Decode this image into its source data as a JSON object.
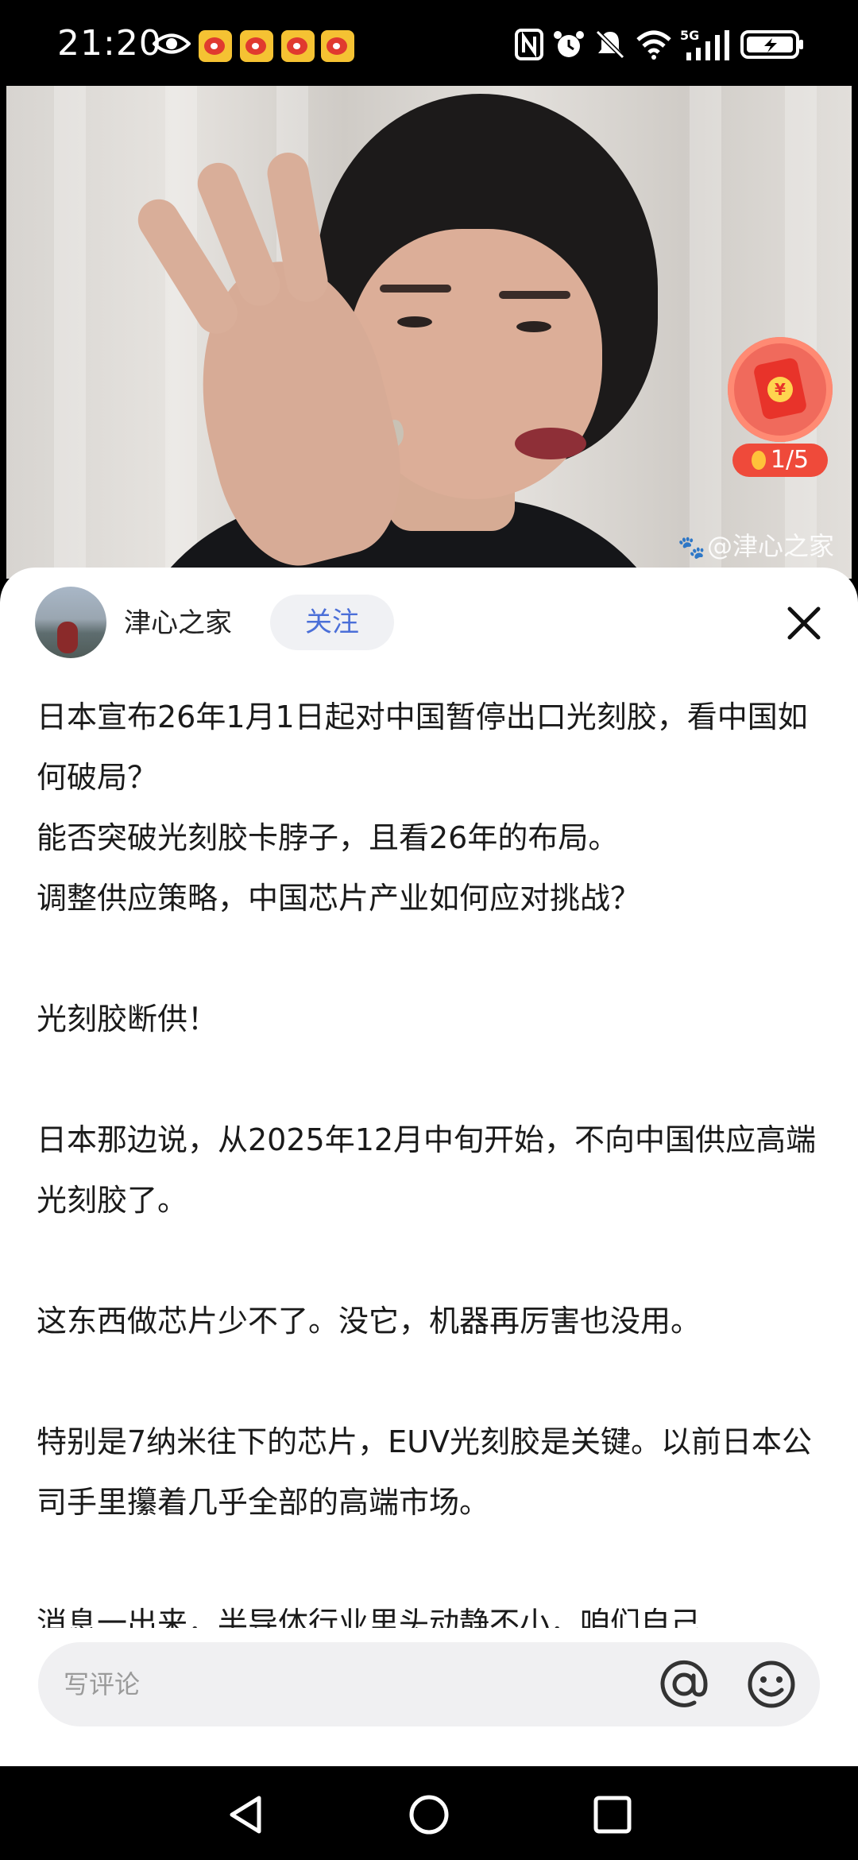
{
  "status_bar": {
    "time": "21:20",
    "left_icons": [
      "eye-icon",
      "weibo-icon",
      "weibo-icon",
      "weibo-icon",
      "weibo-icon"
    ],
    "right_icons": [
      "nfc-icon",
      "alarm-icon",
      "mute-icon",
      "wifi-icon",
      "5g-signal-icon",
      "battery-charging-icon"
    ],
    "network_label": "5G"
  },
  "hero": {
    "watermark": "@津心之家",
    "reward_counter": "1/5"
  },
  "post": {
    "author_name": "津心之家",
    "follow_label": "关注",
    "paragraphs": [
      "日本宣布26年1月1日起对中国暂停出口光刻胶，看中国如何破局？",
      "能否突破光刻胶卡脖子，且看26年的布局。",
      "调整供应策略，中国芯片产业如何应对挑战？",
      "",
      "光刻胶断供！",
      "",
      "日本那边说，从2025年12月中旬开始，不向中国供应高端光刻胶了。",
      "",
      "这东西做芯片少不了。没它，机器再厉害也没用。",
      "",
      "特别是7纳米往下的芯片，EUV光刻胶是关键。以前日本公司手里攥着几乎全部的高端市场。",
      "",
      "消息一出来，半导体行业里头动静不小，咱们自己"
    ]
  },
  "comment_bar": {
    "placeholder": "写评论"
  },
  "nav_bar": {
    "buttons": [
      "back-icon",
      "home-icon",
      "recents-icon"
    ]
  },
  "colors": {
    "follow_text": "#4b6fd8",
    "reward_red": "#ef4a3a"
  }
}
